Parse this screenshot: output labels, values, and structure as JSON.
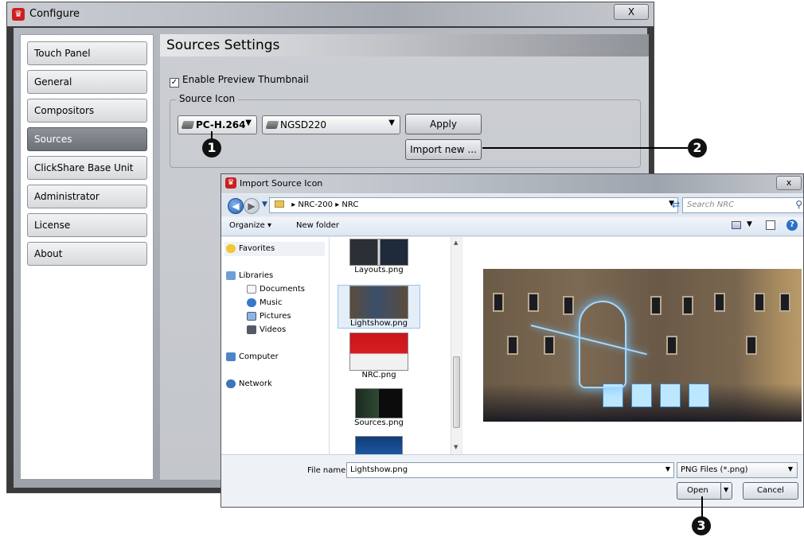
{
  "configure": {
    "title": "Configure",
    "close_glyph": "X",
    "nav": [
      "Touch Panel",
      "General",
      "Compositors",
      "Sources",
      "ClickShare Base Unit",
      "Administrator",
      "License",
      "About"
    ],
    "active_nav": "Sources",
    "heading": "Sources Settings",
    "preview_label": "Enable Preview Thumbnail",
    "preview_checked": true,
    "source_icon_legend": "Source Icon",
    "source_dropdown": "PC-H.264",
    "icon_dropdown": "NGSD220",
    "apply_label": "Apply",
    "import_label": "Import new ..."
  },
  "callouts": [
    "1",
    "2",
    "3"
  ],
  "import_dialog": {
    "title": "Import Source Icon",
    "close_glyph": "x",
    "breadcrumb": [
      "NRC-200",
      "NRC"
    ],
    "search_placeholder": "Search NRC",
    "organize_label": "Organize ▾",
    "new_folder_label": "New folder",
    "favorites": "Favorites",
    "libraries": "Libraries",
    "library_items": [
      "Documents",
      "Music",
      "Pictures",
      "Videos"
    ],
    "computer": "Computer",
    "network": "Network",
    "files": [
      "Layouts.png",
      "Lightshow.png",
      "NRC.png",
      "Sources.png"
    ],
    "selected_file": "Lightshow.png",
    "file_name_label": "File name:",
    "file_name_value": "Lightshow.png",
    "file_type": "PNG Files (*.png)",
    "open_label": "Open",
    "cancel_label": "Cancel"
  },
  "colors": {
    "accent_red": "#cc1f1f",
    "callout": "#111111",
    "selection": "#e3eef9"
  }
}
